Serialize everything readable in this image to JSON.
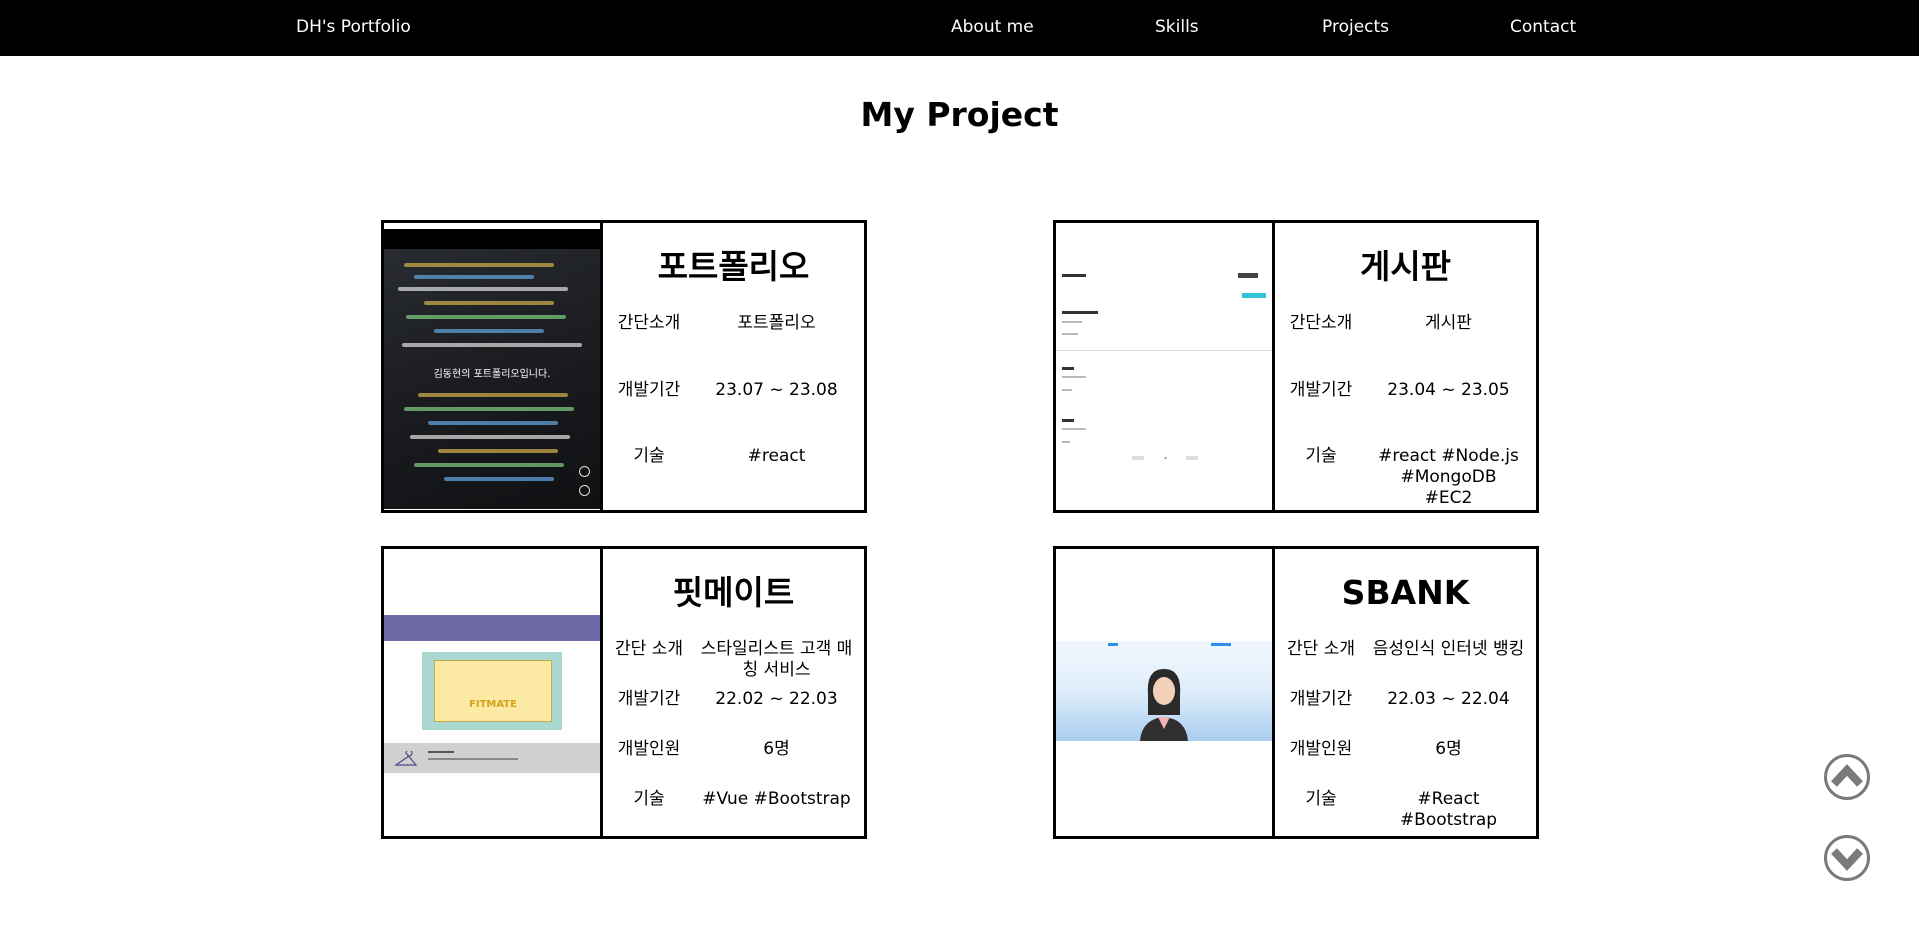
{
  "nav": {
    "brand": "DH's Portfolio",
    "links": [
      "About me",
      "Skills",
      "Projects",
      "Contact"
    ]
  },
  "page": {
    "title": "My Project"
  },
  "projects": [
    {
      "title": "포트폴리오",
      "thumbnail_caption": "김동현의 포트폴리오입니다.",
      "rows": [
        {
          "label": "간단소개",
          "value": "포트폴리오"
        },
        {
          "label": "개발기간",
          "value": "23.07 ~ 23.08"
        },
        {
          "label": "기술",
          "value": "#react"
        }
      ]
    },
    {
      "title": "게시판",
      "rows": [
        {
          "label": "간단소개",
          "value": "게시판"
        },
        {
          "label": "개발기간",
          "value": "23.04 ~ 23.05"
        },
        {
          "label": "기술",
          "value": "#react #Node.js #MongoDB #EC2"
        }
      ]
    },
    {
      "title": "핏메이트",
      "thumbnail_caption": "FITMATE",
      "rows": [
        {
          "label": "간단 소개",
          "value": "스타일리스트 고객 매칭 서비스"
        },
        {
          "label": "개발기간",
          "value": "22.02 ~ 22.03"
        },
        {
          "label": "개발인원",
          "value": "6명"
        },
        {
          "label": "기술",
          "value": "#Vue #Bootstrap"
        }
      ]
    },
    {
      "title": "SBANK",
      "rows": [
        {
          "label": "간단 소개",
          "value": "음성인식 인터넷 뱅킹"
        },
        {
          "label": "개발기간",
          "value": "22.03 ~ 22.04"
        },
        {
          "label": "개발인원",
          "value": "6명"
        },
        {
          "label": "기술",
          "value": "#React #Bootstrap"
        }
      ]
    }
  ],
  "icons": {
    "scroll_up": "chevron-up-icon",
    "scroll_down": "chevron-down-icon"
  },
  "colors": {
    "navbar_bg": "#000000",
    "page_bg": "#ffffff",
    "border": "#000000",
    "scroll_button": "#7a7a7a",
    "fitmate_purple": "#6e6aa8",
    "sbank_sky": "#a9cdf0"
  }
}
